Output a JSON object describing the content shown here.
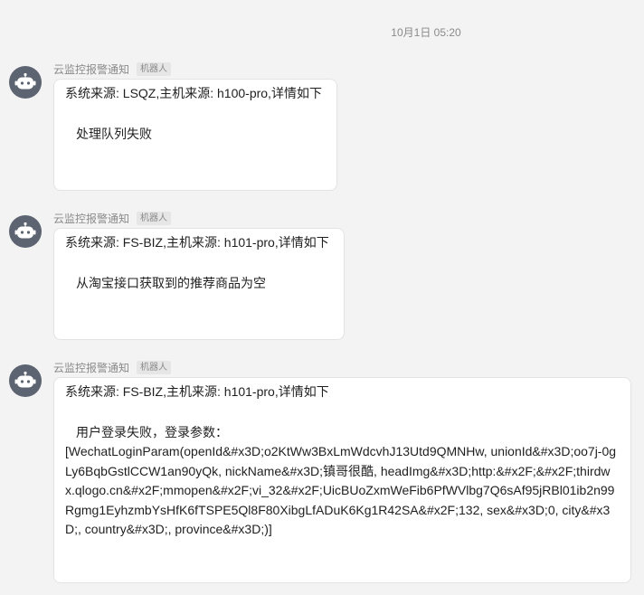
{
  "timestamp": "10月1日 05:20",
  "messages": [
    {
      "sender": "云监控报警通知",
      "tag": "机器人",
      "header": "系统来源: LSQZ,主机来源: h100-pro,详情如下",
      "body": "处理队列失败"
    },
    {
      "sender": "云监控报警通知",
      "tag": "机器人",
      "header": "系统来源: FS-BIZ,主机来源: h101-pro,详情如下",
      "body": "从淘宝接口获取到的推荐商品为空"
    },
    {
      "sender": "云监控报警通知",
      "tag": "机器人",
      "header": "系统来源: FS-BIZ,主机来源: h101-pro,详情如下",
      "body": "用户登录失败，登录参数：",
      "param": "[WechatLoginParam(openId&#x3D;o2KtWw3BxLmWdcvhJ13Utd9QMNHw, unionId&#x3D;oo7j-0gLy6BqbGstlCCW1an90yQk, nickName&#x3D;镇哥很酷, headImg&#x3D;http:&#x2F;&#x2F;thirdwx.qlogo.cn&#x2F;mmopen&#x2F;vi_32&#x2F;UicBUoZxmWeFib6PfWVlbg7Q6sAf95jRBl01ib2n99Rgmg1EyhzmbYsHfK6fTSPE5Ql8F80XibgLfADuK6Kg1R42SA&#x2F;132, sex&#x3D;0, city&#x3D;, country&#x3D;, province&#x3D;)]"
    }
  ]
}
